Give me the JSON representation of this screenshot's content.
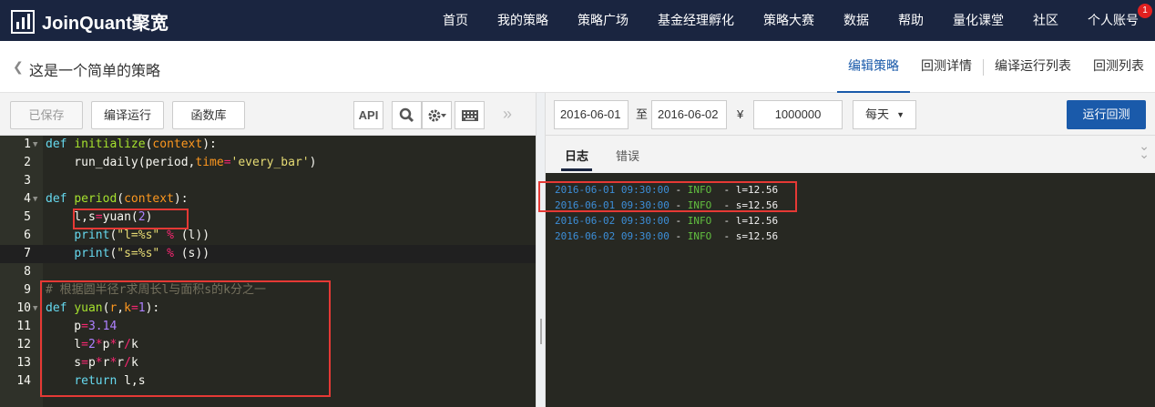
{
  "brand": {
    "name": "JoinQuant聚宽"
  },
  "nav": {
    "items": [
      "首页",
      "我的策略",
      "策略广场",
      "基金经理孵化",
      "策略大赛",
      "数据",
      "帮助",
      "量化课堂",
      "社区",
      "个人账号"
    ],
    "badge": "1"
  },
  "subheader": {
    "title": "这是一个简单的策略",
    "tabs": [
      "编辑策略",
      "回测详情",
      "编译运行列表",
      "回测列表"
    ],
    "active_tab": "编辑策略"
  },
  "editor_toolbar": {
    "saved_label": "已保存",
    "compile_run_label": "编译运行",
    "library_label": "函数库",
    "api_label": "API"
  },
  "code_lines": [
    "def initialize(context):",
    "    run_daily(period,time='every_bar')",
    "",
    "def period(context):",
    "    l,s=yuan(2)",
    "    print(\"l=%s\" % (l))",
    "    print(\"s=%s\" % (s))",
    "",
    "# 根据圆半径r求周长l与面积s的k分之一",
    "def yuan(r,k=1):",
    "    p=3.14",
    "    l=2*p*r/k",
    "    s=p*r*r/k",
    "    return l,s"
  ],
  "backtest": {
    "start_date": "2016-06-01",
    "to_label": "至",
    "end_date": "2016-06-02",
    "currency": "¥",
    "capital": "1000000",
    "frequency": "每天",
    "run_label": "运行回测"
  },
  "log_tabs": {
    "log": "日志",
    "error": "错误"
  },
  "logs": [
    {
      "time": "2016-06-01 09:30:00",
      "sep": " - ",
      "level": "INFO",
      "msg": "  - l=12.56"
    },
    {
      "time": "2016-06-01 09:30:00",
      "sep": " - ",
      "level": "INFO",
      "msg": "  - s=12.56"
    },
    {
      "time": "2016-06-02 09:30:00",
      "sep": " - ",
      "level": "INFO",
      "msg": "  - l=12.56"
    },
    {
      "time": "2016-06-02 09:30:00",
      "sep": " - ",
      "level": "INFO",
      "msg": "  - s=12.56"
    }
  ],
  "colors": {
    "topbar": "#1a2540",
    "accent": "#1a5aaa",
    "editor_bg": "#272822",
    "highlight_box": "#e53935"
  }
}
